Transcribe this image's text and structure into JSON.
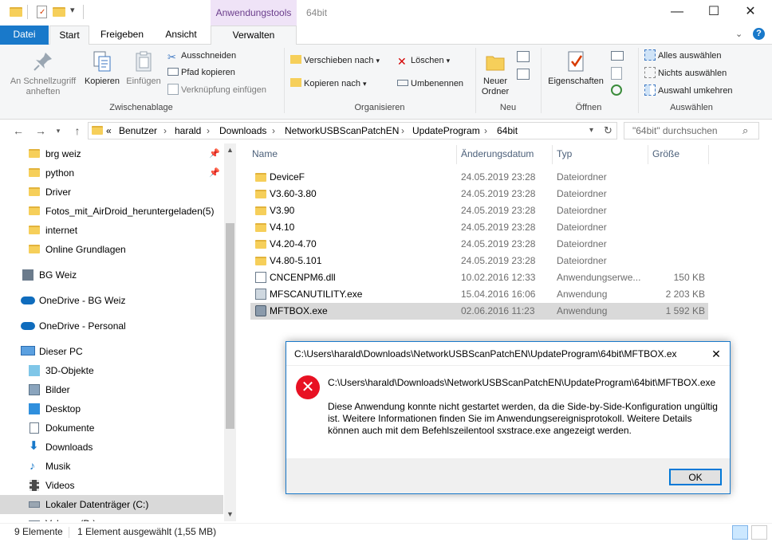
{
  "window": {
    "title": "64bit",
    "context_tab_group": "Anwendungstools",
    "controls": {
      "minimize": "—",
      "maximize": "☐",
      "close": "✕"
    }
  },
  "ribbon_tabs": [
    "Datei",
    "Start",
    "Freigeben",
    "Ansicht",
    "Verwalten"
  ],
  "ribbon": {
    "clipboard": {
      "label": "Zwischenablage",
      "pin": "An Schnellzugriff anheften",
      "copy": "Kopieren",
      "paste": "Einfügen",
      "cut": "Ausschneiden",
      "copy_path": "Pfad kopieren",
      "paste_shortcut": "Verknüpfung einfügen"
    },
    "organize": {
      "label": "Organisieren",
      "move_to": "Verschieben nach",
      "copy_to": "Kopieren nach",
      "delete": "Löschen",
      "rename": "Umbenennen"
    },
    "new": {
      "label": "Neu",
      "new_folder": "Neuer Ordner"
    },
    "open": {
      "label": "Öffnen",
      "properties": "Eigenschaften"
    },
    "select": {
      "label": "Auswählen",
      "select_all": "Alles auswählen",
      "select_none": "Nichts auswählen",
      "invert": "Auswahl umkehren"
    }
  },
  "address": {
    "prefix": "«",
    "crumbs": [
      "Benutzer",
      "harald",
      "Downloads",
      "NetworkUSBScanPatchEN",
      "UpdateProgram",
      "64bit"
    ],
    "search_placeholder": "\"64bit\" durchsuchen"
  },
  "nav": {
    "items": [
      {
        "label": "brg weiz",
        "icon": "folder-icon",
        "pinned": true
      },
      {
        "label": "python",
        "icon": "folder-icon",
        "pinned": true
      },
      {
        "label": "Driver",
        "icon": "folder-icon"
      },
      {
        "label": "Fotos_mit_AirDroid_heruntergeladen(5)",
        "icon": "folder-icon"
      },
      {
        "label": "internet",
        "icon": "folder-icon"
      },
      {
        "label": "Online Grundlagen",
        "icon": "folder-icon"
      },
      {
        "label": "BG Weiz",
        "icon": "building-icon"
      },
      {
        "label": "OneDrive - BG Weiz",
        "icon": "cloud-icon"
      },
      {
        "label": "OneDrive - Personal",
        "icon": "cloud-icon"
      },
      {
        "label": "Dieser PC",
        "icon": "computer-icon"
      },
      {
        "label": "3D-Objekte",
        "icon": "cube-icon"
      },
      {
        "label": "Bilder",
        "icon": "pictures-icon"
      },
      {
        "label": "Desktop",
        "icon": "desktop-icon"
      },
      {
        "label": "Dokumente",
        "icon": "document-icon"
      },
      {
        "label": "Downloads",
        "icon": "download-arrow-icon"
      },
      {
        "label": "Musik",
        "icon": "music-note-icon"
      },
      {
        "label": "Videos",
        "icon": "video-icon"
      },
      {
        "label": "Lokaler Datenträger (C:)",
        "icon": "drive-icon",
        "selected": true
      },
      {
        "label": "Volume (D:)",
        "icon": "drive-icon"
      }
    ]
  },
  "columns": [
    "Name",
    "Änderungsdatum",
    "Typ",
    "Größe"
  ],
  "files": [
    {
      "name": "DeviceF",
      "date": "24.05.2019 23:28",
      "type": "Dateiordner",
      "size": "",
      "icon": "folder-icon"
    },
    {
      "name": "V3.60-3.80",
      "date": "24.05.2019 23:28",
      "type": "Dateiordner",
      "size": "",
      "icon": "folder-icon"
    },
    {
      "name": "V3.90",
      "date": "24.05.2019 23:28",
      "type": "Dateiordner",
      "size": "",
      "icon": "folder-icon"
    },
    {
      "name": "V4.10",
      "date": "24.05.2019 23:28",
      "type": "Dateiordner",
      "size": "",
      "icon": "folder-icon"
    },
    {
      "name": "V4.20-4.70",
      "date": "24.05.2019 23:28",
      "type": "Dateiordner",
      "size": "",
      "icon": "folder-icon"
    },
    {
      "name": "V4.80-5.101",
      "date": "24.05.2019 23:28",
      "type": "Dateiordner",
      "size": "",
      "icon": "folder-icon"
    },
    {
      "name": "CNCENPM6.dll",
      "date": "10.02.2016 12:33",
      "type": "Anwendungserwe...",
      "size": "150 KB",
      "icon": "dll-icon"
    },
    {
      "name": "MFSCANUTILITY.exe",
      "date": "15.04.2016 16:06",
      "type": "Anwendung",
      "size": "2 203 KB",
      "icon": "exe-icon"
    },
    {
      "name": "MFTBOX.exe",
      "date": "02.06.2016 11:23",
      "type": "Anwendung",
      "size": "1 592 KB",
      "icon": "exe-icon",
      "selected": true
    }
  ],
  "status": {
    "count": "9 Elemente",
    "selection": "1 Element ausgewählt (1,55 MB)"
  },
  "dialog": {
    "title": "C:\\Users\\harald\\Downloads\\NetworkUSBScanPatchEN\\UpdateProgram\\64bit\\MFTBOX.exe",
    "path": "C:\\Users\\harald\\Downloads\\NetworkUSBScanPatchEN\\UpdateProgram\\64bit\\MFTBOX.exe",
    "message": "Diese Anwendung konnte nicht gestartet werden, da die Side-by-Side-Konfiguration ungültig ist. Weitere Informationen finden Sie im Anwendungsereignisprotokoll. Weitere Details können auch mit dem Befehlszeilentool sxstrace.exe angezeigt werden.",
    "ok": "OK",
    "close": "✕"
  },
  "colors": {
    "accent": "#1979ca",
    "selection": "#d9d9d9",
    "error": "#e81123",
    "folder": "#f6cf5a"
  }
}
